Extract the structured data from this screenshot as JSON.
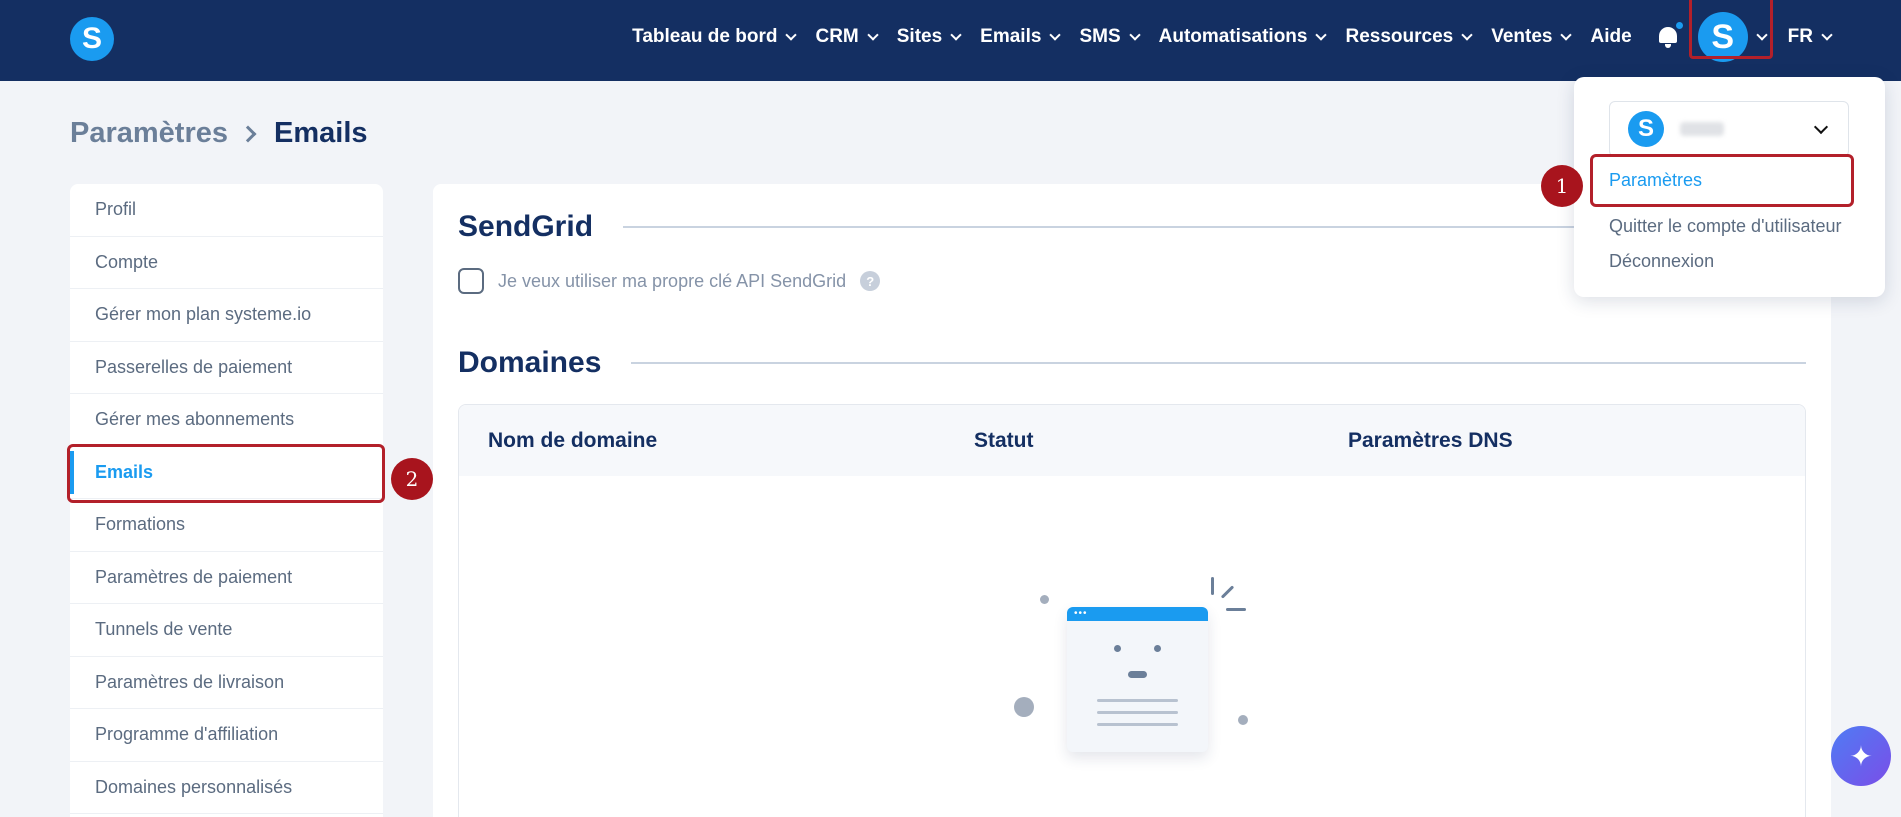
{
  "logo": {
    "letter": "S"
  },
  "nav": {
    "items": [
      {
        "label": "Tableau de bord",
        "has_dropdown": true
      },
      {
        "label": "CRM",
        "has_dropdown": true
      },
      {
        "label": "Sites",
        "has_dropdown": true
      },
      {
        "label": "Emails",
        "has_dropdown": true
      },
      {
        "label": "SMS",
        "has_dropdown": true
      },
      {
        "label": "Automatisations",
        "has_dropdown": true
      },
      {
        "label": "Ressources",
        "has_dropdown": true
      },
      {
        "label": "Ventes",
        "has_dropdown": true
      },
      {
        "label": "Aide",
        "has_dropdown": false
      }
    ],
    "avatar_letter": "S",
    "language": "FR"
  },
  "breadcrumb": {
    "parent": "Paramètres",
    "current": "Emails"
  },
  "sidebar": {
    "items": [
      {
        "label": "Profil",
        "active": false
      },
      {
        "label": "Compte",
        "active": false
      },
      {
        "label": "Gérer mon plan systeme.io",
        "active": false
      },
      {
        "label": "Passerelles de paiement",
        "active": false
      },
      {
        "label": "Gérer mes abonnements",
        "active": false
      },
      {
        "label": "Emails",
        "active": true
      },
      {
        "label": "Formations",
        "active": false
      },
      {
        "label": "Paramètres de paiement",
        "active": false
      },
      {
        "label": "Tunnels de vente",
        "active": false
      },
      {
        "label": "Paramètres de livraison",
        "active": false
      },
      {
        "label": "Programme d'affiliation",
        "active": false
      },
      {
        "label": "Domaines personnalisés",
        "active": false
      }
    ]
  },
  "sendgrid": {
    "title": "SendGrid",
    "checkbox_label": "Je veux utiliser ma propre clé API SendGrid",
    "help": "?"
  },
  "domains": {
    "title": "Domaines",
    "columns": [
      "Nom de domaine",
      "Statut",
      "Paramètres DNS"
    ]
  },
  "dropdown": {
    "account_letter": "S",
    "items": [
      "Paramètres",
      "Quitter le compte d'utilisateur",
      "Déconnexion"
    ]
  },
  "annotations": {
    "step1": "1",
    "step2": "2"
  },
  "colors": {
    "nav_bg": "#142f62",
    "accent": "#1a9bf0",
    "highlight": "#b3202a"
  }
}
